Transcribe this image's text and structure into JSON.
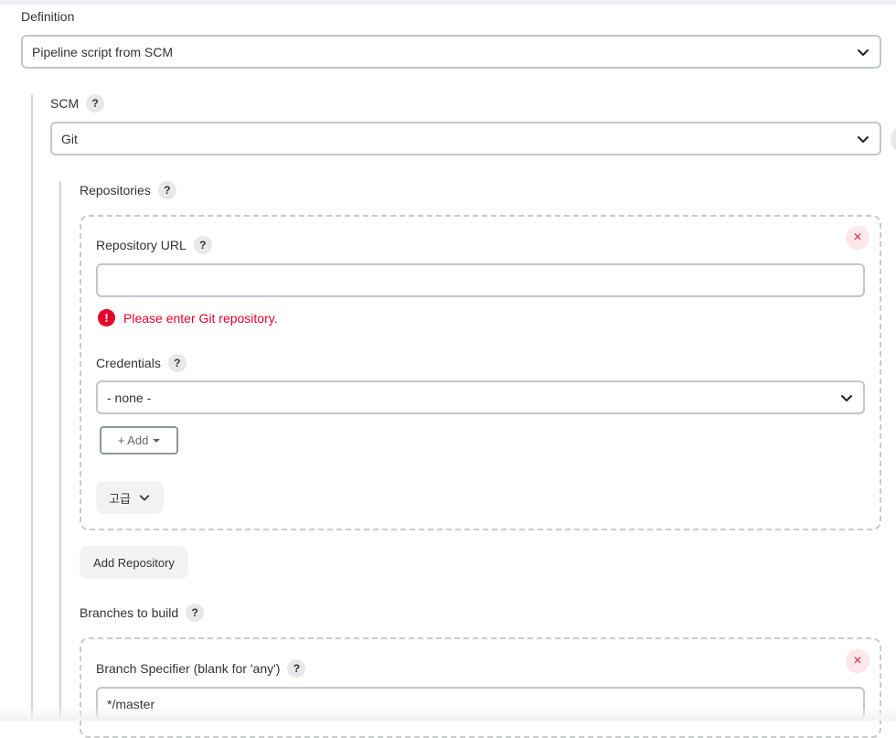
{
  "definition": {
    "label": "Definition",
    "selected": "Pipeline script from SCM"
  },
  "scm": {
    "label": "SCM",
    "help": "?",
    "selected": "Git"
  },
  "repositories": {
    "label": "Repositories",
    "help": "?",
    "repository_url": {
      "label": "Repository URL",
      "help": "?",
      "value": "",
      "error": "Please enter Git repository.",
      "error_icon": "!"
    },
    "credentials": {
      "label": "Credentials",
      "help": "?",
      "selected": "- none -"
    },
    "add_button": "+ Add",
    "advanced_button": "고급",
    "remove_icon": "×",
    "add_repository_button": "Add Repository"
  },
  "branches": {
    "label": "Branches to build",
    "help": "?",
    "branch_specifier": {
      "label": "Branch Specifier (blank for 'any')",
      "help": "?",
      "value": "*/master"
    },
    "remove_icon": "×"
  }
}
